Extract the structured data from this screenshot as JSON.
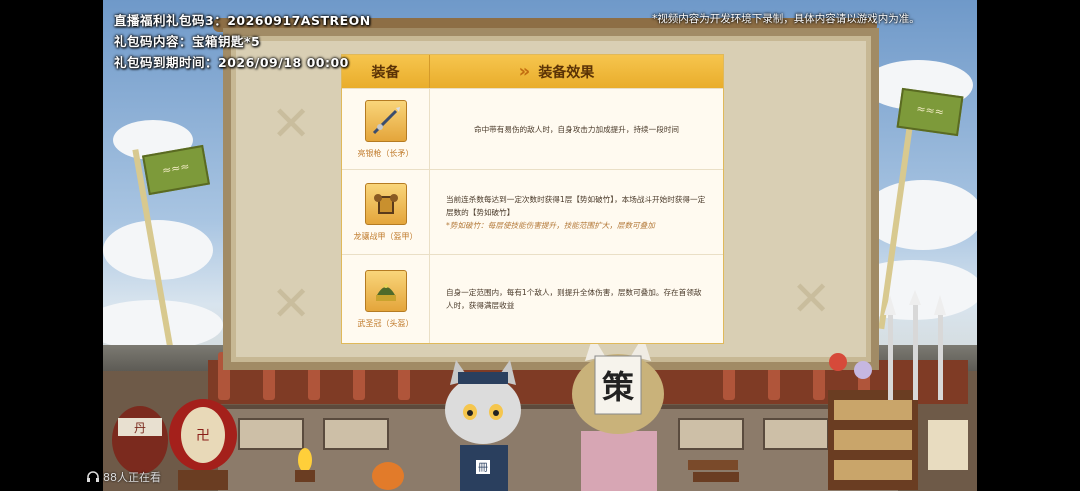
{
  "overlay": {
    "code_line": "直播福利礼包码3：20260917ASTREON",
    "content_line": "礼包码内容：宝箱钥匙*5",
    "expiry_line": "礼包码到期时间：2026/09/18 00:00",
    "notice": "*视频内容为开发环境下录制，具体内容请以游戏内为准。"
  },
  "table": {
    "col_equipment": "装备",
    "col_effect": "装备效果",
    "col_effect_marker": "»",
    "rows": [
      {
        "name": "亮银枪（长矛）",
        "icon": "spear-icon",
        "effect": "命中带有易伤的敌人时，自身攻击力加成提升，持续一段时间",
        "note": ""
      },
      {
        "name": "龙骧战甲（盔甲）",
        "icon": "armor-icon",
        "effect": "当前连杀数每达到一定次数时获得1层【势如破竹】，本场战斗开始时获得一定层数的【势如破竹】",
        "note": "*势如破竹：每层使技能伤害提升，技能范围扩大，层数可叠加"
      },
      {
        "name": "武圣冠（头盔）",
        "icon": "helmet-icon",
        "effect": "自身一定范围内，每有1个敌人，则提升全体伤害，层数可叠加。存在首领敌人时，获得满层收益",
        "note": ""
      }
    ]
  },
  "scene": {
    "mask_glyph": "策",
    "badge_glyph": "冊",
    "drum_glyph": "卍",
    "jar_glyph": "丹"
  },
  "viewers": {
    "text": "88人正在看",
    "icon": "headphones-icon"
  },
  "colors": {
    "header_gold": "#f0b83a",
    "item_name": "#c07b2c",
    "note": "#b47a3a"
  }
}
